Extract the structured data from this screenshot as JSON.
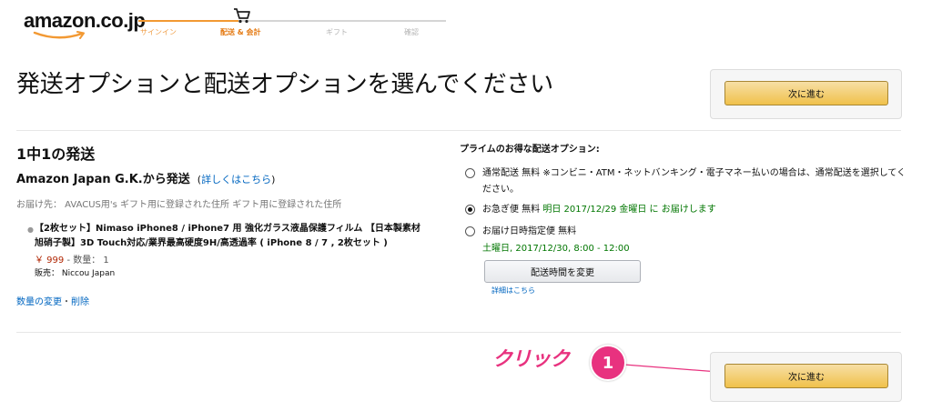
{
  "header": {
    "logo_text": "amazon.co.jp",
    "steps": [
      "サインイン",
      "配送 & 会計",
      "ギフト",
      "確認"
    ]
  },
  "page_title": "発送オプションと配送オプションを選んでください",
  "continue_top_label": "次に進む",
  "continue_bottom_label": "次に進む",
  "shipment": {
    "title": "1中1の発送",
    "seller_prefix": "Amazon Japan G.K.から発送",
    "details_link": "詳しくはこちら",
    "address": "お届け先： AVACUS用's ギフト用に登録された住所 ギフト用に登録された住所",
    "product_name": "【2枚セット】Nimaso iPhone8 / iPhone7 用 強化ガラス液晶保護フィルム 【日本製素材旭硝子製】3D Touch対応/業界最高硬度9H/高透過率 ( iPhone 8 / 7 , 2枚セット )",
    "price": "￥ 999",
    "quantity": "- 数量： 1",
    "seller_name": "販売： Niccou Japan",
    "change_link": "数量の変更",
    "delete_link": "削除"
  },
  "options": {
    "heading": "プライムのお得な配送オプション:",
    "standard": "通常配送 無料 ※コンビニ・ATM・ネットバンキング・電子マネー払いの場合は、通常配送を選択してください。",
    "express_label": "お急ぎ便 無料",
    "express_date": "明日 2017/12/29 金曜日 に お届けします",
    "scheduled_label": "お届け日時指定便 無料",
    "scheduled_date": "土曜日, 2017/12/30, 8:00 - 12:00",
    "change_time_button": "配送時間を変更",
    "details_link": "詳細はこちら",
    "selected": "express"
  },
  "annotation": {
    "click_text": "クリック",
    "step_number": "1",
    "color": "#e8327f"
  },
  "colors": {
    "accent_orange": "#e47911",
    "link_blue": "#0066c0",
    "price_red": "#b12704",
    "green": "#007600"
  }
}
